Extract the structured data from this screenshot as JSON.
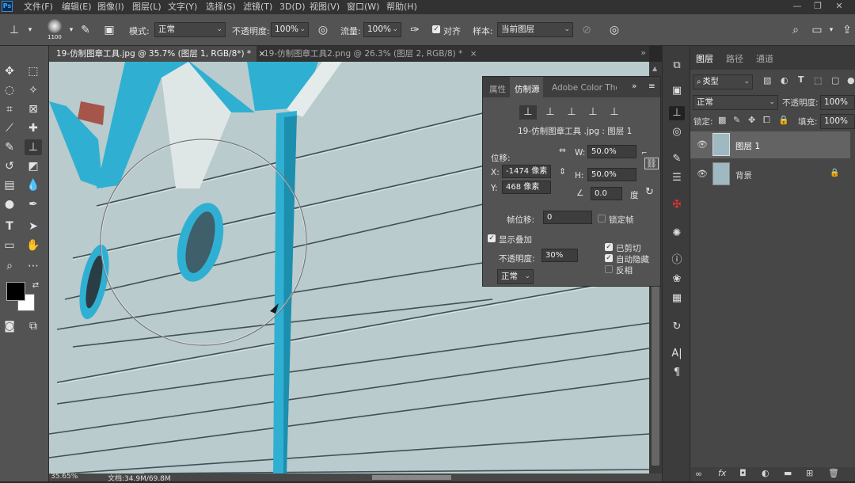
{
  "app": {
    "logo": "Ps"
  },
  "menubar": {
    "items": [
      "文件(F)",
      "编辑(E)",
      "图像(I)",
      "图层(L)",
      "文字(Y)",
      "选择(S)",
      "滤镜(T)",
      "3D(D)",
      "视图(V)",
      "窗口(W)",
      "帮助(H)"
    ],
    "min": "—",
    "max": "❐",
    "close": "✕"
  },
  "options": {
    "brush_size": "1100",
    "mode_label": "模式:",
    "mode_value": "正常",
    "opacity_label": "不透明度:",
    "opacity_value": "100%",
    "flow_label": "流量:",
    "flow_value": "100%",
    "aligned_label": "对齐",
    "sample_label": "样本:",
    "sample_value": "当前图层"
  },
  "tabs": [
    {
      "title": "19-仿制图章工具.jpg @ 35.7% (图层 1, RGB/8*) *",
      "close": "×"
    },
    {
      "title": "19-仿制图章工具2.png @ 26.3% (图层 2, RGB/8) *",
      "close": "×"
    }
  ],
  "status": {
    "zoom": "35.65%",
    "doc": "文档:34.9M/69.8M"
  },
  "clone_panel": {
    "tabs": [
      "属性",
      "仿制源",
      "Adobe Color Them"
    ],
    "source_label": "19-仿制图章工具 .jpg : 图层 1",
    "offset_label": "位移:",
    "x_label": "X:",
    "x_value": "-1474 像素",
    "y_label": "Y:",
    "y_value": "468 像素",
    "w_label": "W:",
    "w_value": "50.0%",
    "h_label": "H:",
    "h_value": "50.0%",
    "angle_value": "0.0",
    "angle_unit": "度",
    "frame_offset_label": "帧位移:",
    "frame_offset_value": "0",
    "lock_frame_label": "锁定帧",
    "show_overlay_label": "显示叠加",
    "opacity_label": "不透明度:",
    "opacity_value": "30%",
    "clipped_label": "已剪切",
    "autohide_label": "自动隐藏",
    "invert_label": "反相",
    "blend_value": "正常"
  },
  "layers_panel": {
    "tabs": [
      "图层",
      "路径",
      "通道"
    ],
    "filter_label": "类型",
    "blend_mode": "正常",
    "opacity_label": "不透明度:",
    "opacity_value": "100%",
    "lock_label": "锁定:",
    "fill_label": "填充:",
    "fill_value": "100%",
    "layers": [
      {
        "name": "图层 1",
        "selected": true
      },
      {
        "name": "背景",
        "locked": true
      }
    ]
  },
  "colors": {
    "accent": "#31a8ff",
    "cyan": "#2fb0d3",
    "wall": "#b9cbcc",
    "panel": "#535353"
  }
}
